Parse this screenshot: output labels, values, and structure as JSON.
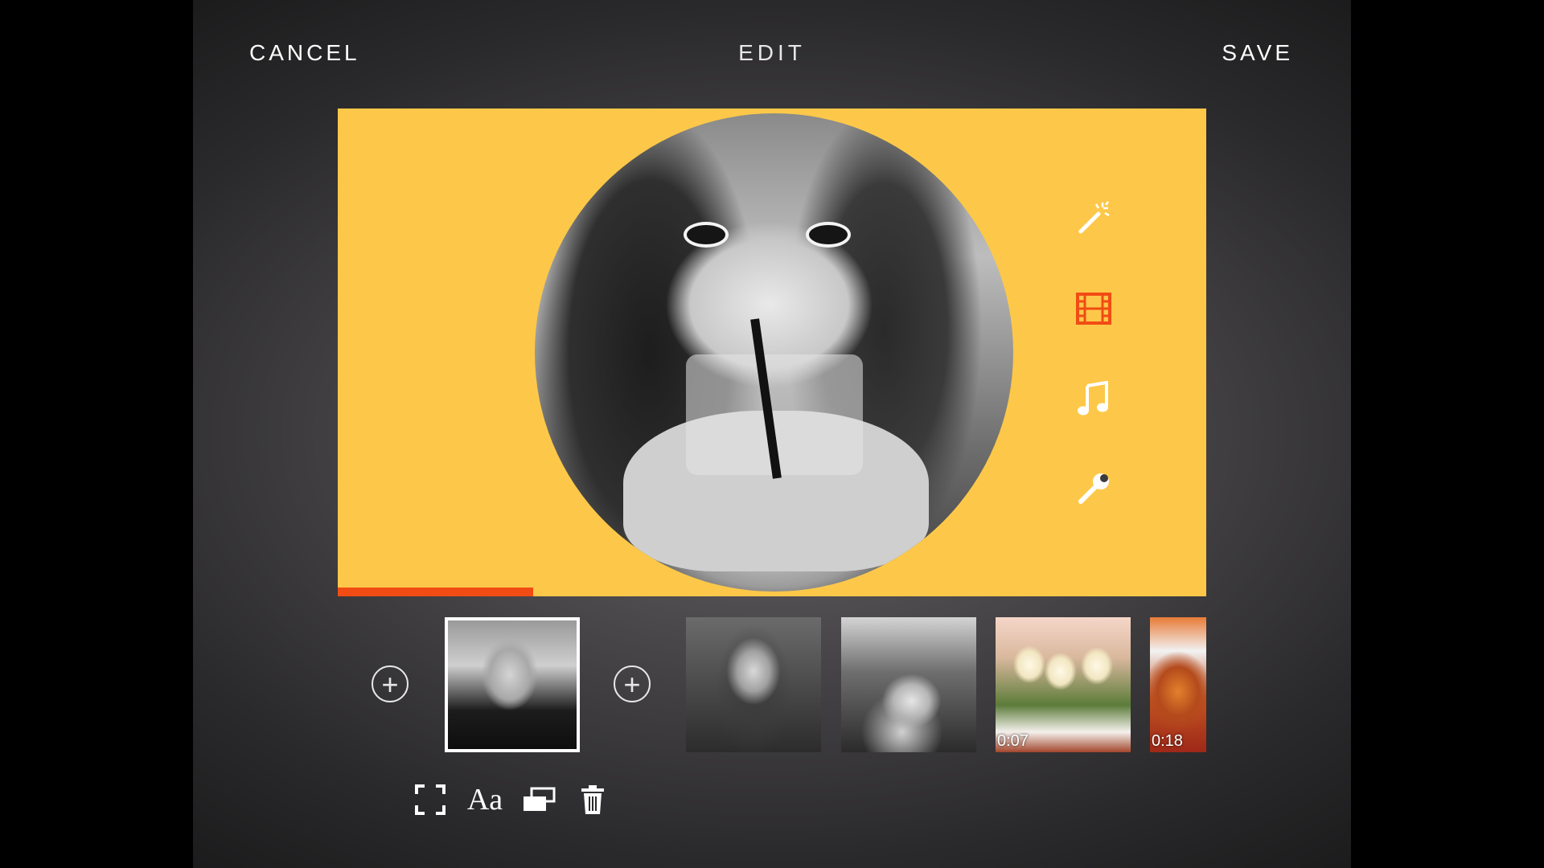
{
  "header": {
    "cancel_label": "CANCEL",
    "title": "EDIT",
    "save_label": "SAVE"
  },
  "preview": {
    "background_color": "#fdc849",
    "progress_fraction": 0.225,
    "progress_color": "#f14c14"
  },
  "tools": [
    {
      "name": "magic-wand-icon",
      "active": false
    },
    {
      "name": "film-strip-icon",
      "active": true,
      "color": "#f14c14"
    },
    {
      "name": "music-note-icon",
      "active": false
    },
    {
      "name": "wrench-icon",
      "active": false
    },
    {
      "name": "grid-icon",
      "active": false
    }
  ],
  "timeline": {
    "add_label": "+",
    "clips": [
      {
        "id": "clip-1",
        "selected": true,
        "duration": ""
      },
      {
        "id": "clip-2",
        "selected": false,
        "duration": ""
      },
      {
        "id": "clip-3",
        "selected": false,
        "duration": ""
      },
      {
        "id": "clip-4",
        "selected": false,
        "duration": "0:07"
      },
      {
        "id": "clip-5",
        "selected": false,
        "duration": "0:18"
      }
    ]
  },
  "actions": {
    "text_glyph": "Aa",
    "icons": [
      "crop-icon",
      "text-style-icon",
      "layers-icon",
      "trash-icon"
    ]
  }
}
